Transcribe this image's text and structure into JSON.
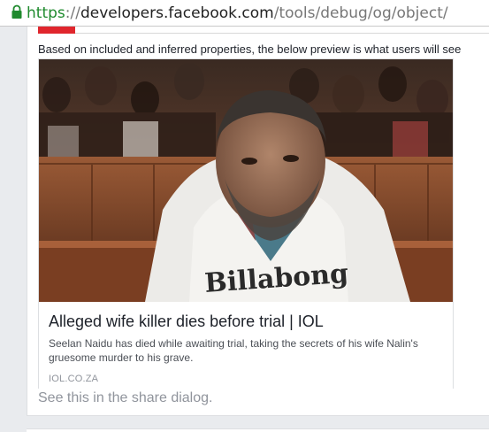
{
  "browser": {
    "url_scheme": "https",
    "url_separator": "://",
    "url_host": "developers.facebook.com",
    "url_path": "/tools/debug/og/object/",
    "secure_color": "#1f8a2e"
  },
  "preview": {
    "intro_text": "Based on included and inferred properties, the below preview is what users will see",
    "card": {
      "image_alt": "Man in white Billabong hoodie seated in courtroom",
      "title": "Alleged wife killer dies before trial | IOL",
      "description": "Seelan Naidu has died while awaiting trial, taking the secrets of his wife Nalin's gruesome murder to his grave.",
      "domain": "IOL.CO.ZA"
    },
    "share_dialog_text": "See this in the share dialog.",
    "accent_color": "#e0262d"
  }
}
